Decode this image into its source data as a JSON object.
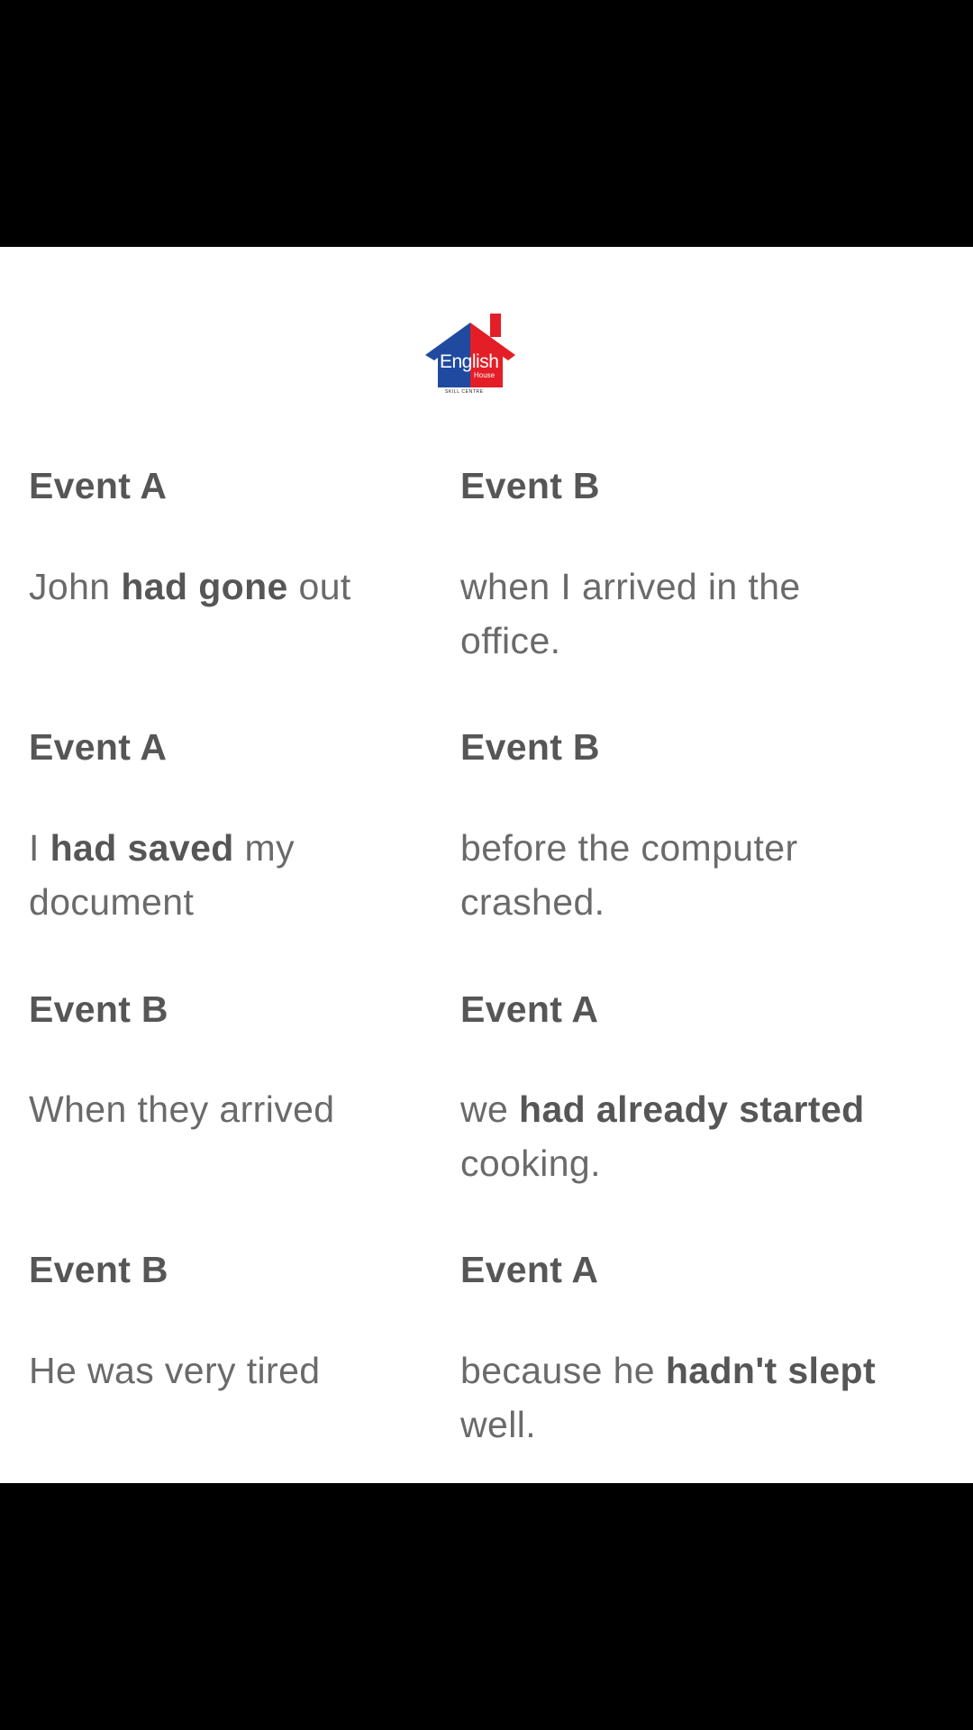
{
  "logo": {
    "word_main": "English",
    "word_sub": "House",
    "tagline": "SKILL CENTRE",
    "colors": {
      "blue": "#1f4aa0",
      "red": "#e41e26"
    }
  },
  "pairs": [
    {
      "left_heading": "Event A",
      "right_heading": "Event B",
      "left_parts": {
        "pre": "John ",
        "bold": "had gone",
        "post": " out"
      },
      "right_parts": {
        "pre": "when I arrived in the office.",
        "bold": "",
        "post": ""
      }
    },
    {
      "left_heading": "Event A",
      "right_heading": "Event B",
      "left_parts": {
        "pre": "I ",
        "bold": "had saved",
        "post": " my document"
      },
      "right_parts": {
        "pre": "before the computer crashed.",
        "bold": "",
        "post": ""
      }
    },
    {
      "left_heading": "Event B",
      "right_heading": "Event A",
      "left_parts": {
        "pre": "When they arrived",
        "bold": "",
        "post": ""
      },
      "right_parts": {
        "pre": "we ",
        "bold": "had already started",
        "post": " cooking."
      }
    },
    {
      "left_heading": "Event B",
      "right_heading": "Event A",
      "left_parts": {
        "pre": "He was very tired",
        "bold": "",
        "post": ""
      },
      "right_parts": {
        "pre": "because he ",
        "bold": "hadn't slept",
        "post": " well."
      }
    }
  ]
}
